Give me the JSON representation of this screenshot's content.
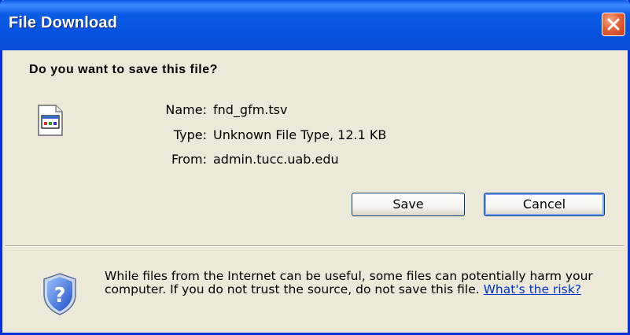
{
  "window": {
    "title": "File Download",
    "close_label": "Close"
  },
  "question": "Do you want to save this file?",
  "file": {
    "name_label": "Name:",
    "name_value": "fnd_gfm.tsv",
    "type_label": "Type:",
    "type_value": "Unknown File Type, 12.1 KB",
    "from_label": "From:",
    "from_value": "admin.tucc.uab.edu"
  },
  "buttons": {
    "save": "Save",
    "cancel": "Cancel"
  },
  "warning": {
    "text": "While files from the Internet can be useful, some files can potentially harm your computer. If you do not trust the source, do not save this file.",
    "link": "What's the risk?"
  },
  "icons": {
    "file": "file-type-icon",
    "shield": "shield-question-icon",
    "close": "close-icon"
  },
  "colors": {
    "titlebar": "#0a58e8",
    "dialog_bg": "#ece9d8",
    "close_button": "#e2643a",
    "link": "#0033cc"
  }
}
